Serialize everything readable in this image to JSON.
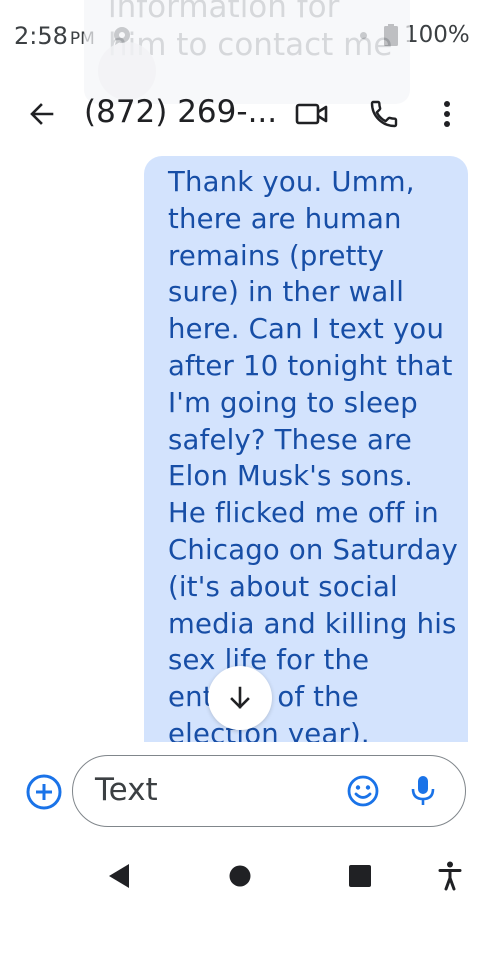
{
  "status_bar": {
    "time": "2:58",
    "ampm": "PM",
    "battery": "100%"
  },
  "notification_ghost": {
    "text": "information for him to contact me"
  },
  "app_bar": {
    "title": "(872) 269-...",
    "icons": [
      "back-arrow-icon",
      "video-call-icon",
      "phone-icon",
      "more-vert-icon"
    ]
  },
  "conversation": {
    "message": "Thank you. Umm, there are human remains (pretty sure) in ther wall here. Can I text you after 10 tonight that I'm going to sleep safely? These are Elon Musk's sons. He flicked me off in Chicago on Saturday (it's about social media and killing his sex life for the entirity of the election year)."
  },
  "compose": {
    "placeholder": "Text"
  },
  "colors": {
    "bubble": "#d3e3fd",
    "bubble_text": "#174ea6",
    "accent": "#1a73e8"
  }
}
